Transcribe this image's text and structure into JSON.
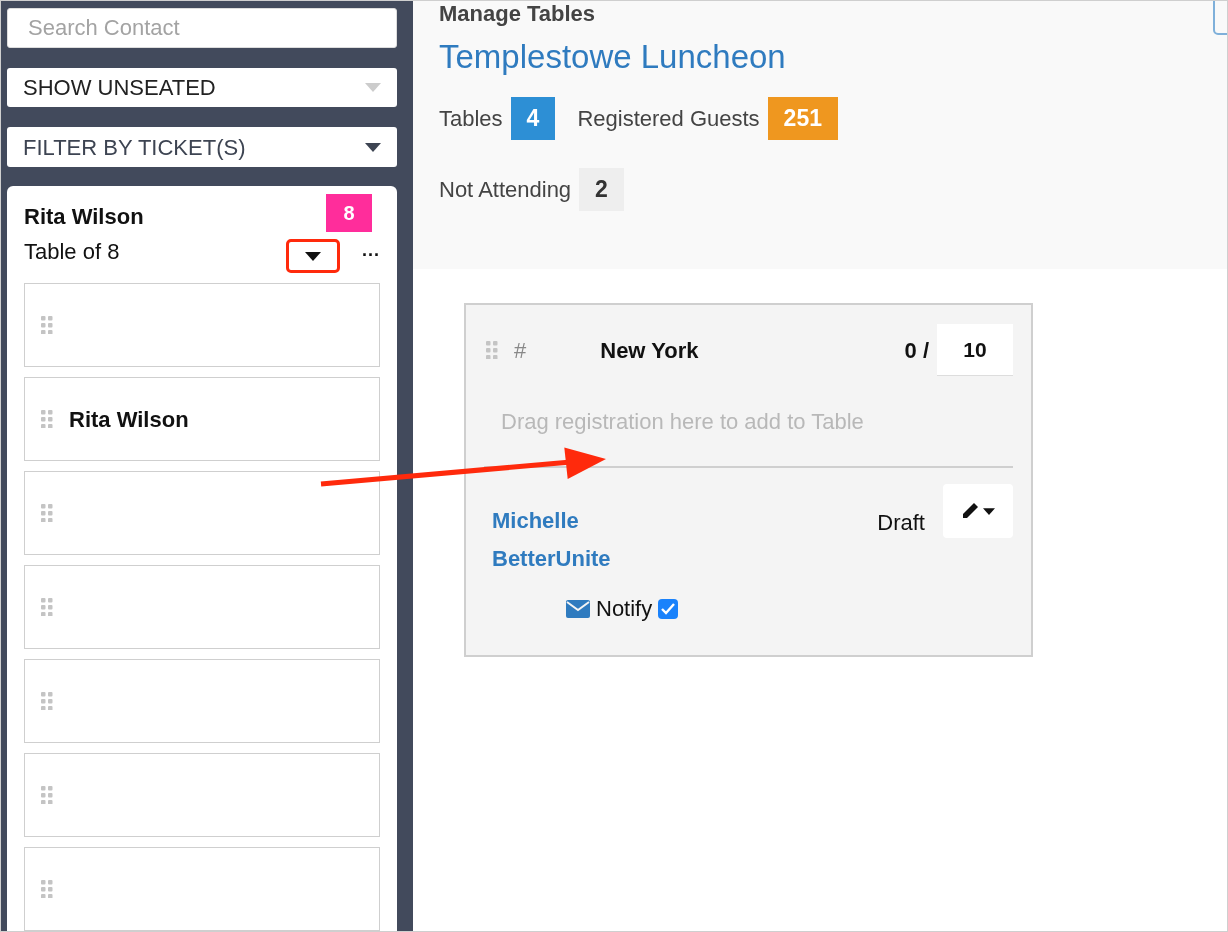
{
  "sidebar": {
    "search": {
      "placeholder": "Search Contact"
    },
    "filters": [
      {
        "label": "SHOW UNSEATED",
        "disabled": true
      },
      {
        "label": "FILTER BY TICKET(S)",
        "disabled": false
      }
    ],
    "group": {
      "name": "Rita Wilson",
      "count": "8",
      "subtitle": "Table of 8",
      "more": "...",
      "seats": [
        {
          "kind": "empty"
        },
        {
          "kind": "guest",
          "name": "Rita Wilson"
        },
        {
          "kind": "empty"
        },
        {
          "kind": "empty"
        },
        {
          "kind": "empty"
        },
        {
          "kind": "empty"
        },
        {
          "kind": "empty"
        }
      ]
    }
  },
  "header": {
    "heading": "Manage Tables",
    "event": "Templestowe Luncheon",
    "stats": [
      {
        "label": "Tables",
        "count": "4",
        "color": "#2d8fd5"
      },
      {
        "label": "Registered Guests",
        "count": "251",
        "color": "#ef971f"
      },
      {
        "label": "Not Attending",
        "count": "2",
        "color": "#eeeeee"
      }
    ]
  },
  "table_card": {
    "number": "#",
    "name": "New York",
    "seated": "0 /",
    "capacity": "10",
    "drop_hint": "Drag registration here to add to Table",
    "guests": [
      {
        "name": "Michelle BetterUnite",
        "status": "Draft",
        "notify": "Notify",
        "checked": true
      }
    ]
  }
}
